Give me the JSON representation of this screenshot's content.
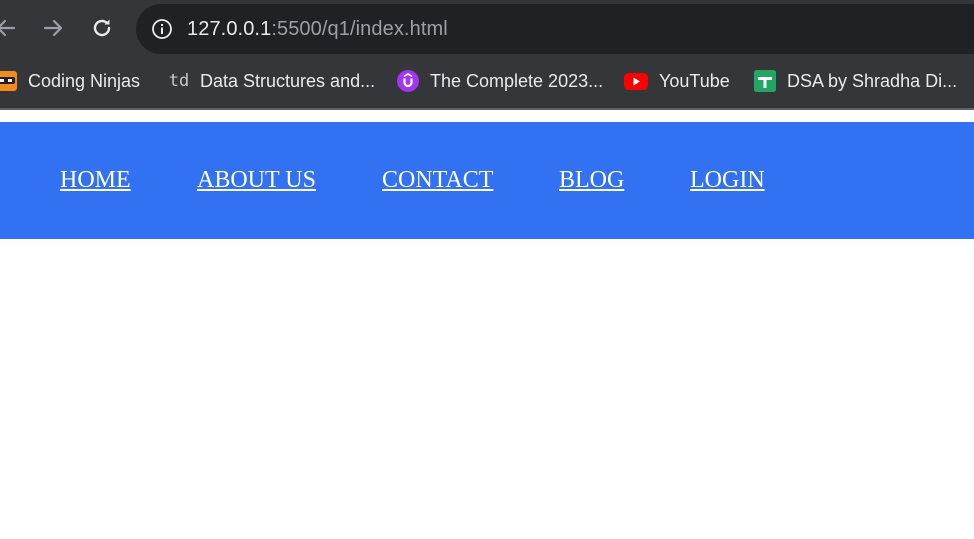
{
  "browser": {
    "url_host": "127.0.0.1",
    "url_rest": ":5500/q1/index.html",
    "bookmarks": [
      {
        "label": "Coding Ninjas",
        "icon": "coding-ninjas-icon"
      },
      {
        "label": "Data Structures and...",
        "icon": "td-icon",
        "icon_text": "td"
      },
      {
        "label": "The Complete 2023...",
        "icon": "udemy-icon"
      },
      {
        "label": "YouTube",
        "icon": "youtube-icon"
      },
      {
        "label": "DSA by Shradha Di...",
        "icon": "google-sheets-icon"
      }
    ]
  },
  "navbar": {
    "links": [
      "HOME",
      "ABOUT US",
      "CONTACT",
      "BLOG",
      "LOGIN"
    ],
    "background_color": "#3271f2",
    "link_color": "#ffffff"
  }
}
